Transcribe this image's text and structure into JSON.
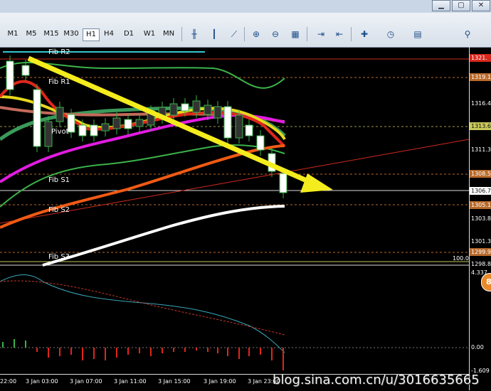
{
  "window": {
    "minimize": "▁",
    "maximize": "▢",
    "close": "✕"
  },
  "toolbar": {
    "timeframes": [
      "M1",
      "M5",
      "M15",
      "M30",
      "H1",
      "H4",
      "D1",
      "W1",
      "MN"
    ],
    "active_timeframe": "H1"
  },
  "price_axis": {
    "labels": [
      "1321.",
      "1319.1",
      "1316.4",
      "1313.6",
      "1311.3",
      "1308.5",
      "1306.7",
      "1305.1",
      "1303.8",
      "1301.3",
      "1299.9",
      "1298.8",
      "4.337",
      "0.00",
      "-1.609"
    ]
  },
  "fib_levels": [
    "Fib R2",
    "Fib R1",
    "Pivot",
    "Fib S1",
    "Fib S2",
    "Fib S3"
  ],
  "level_marker": "100.0",
  "time_axis": [
    "22:00",
    "3 Jan 03:00",
    "3 Jan 07:00",
    "3 Jan 11:00",
    "3 Jan 15:00",
    "3 Jan 19:00",
    "3 Jan 23:00"
  ],
  "watermark": "blog.sina.com.cn/u/3016635665",
  "badge": "8",
  "colors": {
    "bollinger": "#3cb24a",
    "ma_red": "#e0261b",
    "ma_yellow": "#e7d81c",
    "ma_magenta": "#e21ce2",
    "ma_orange": "#f05a14",
    "ma_white": "#ffffff",
    "trend_arrow": "#f4ec1d",
    "macd_signal": "#c0392b",
    "macd_line": "#3aa6b8"
  },
  "icons": [
    "new-order-icon",
    "zoom-in-icon",
    "zoom-out-icon",
    "tile-icon",
    "autoscroll-icon",
    "chart-shift-icon",
    "indicators-icon",
    "periods-icon",
    "templates-icon",
    "search-icon"
  ]
}
